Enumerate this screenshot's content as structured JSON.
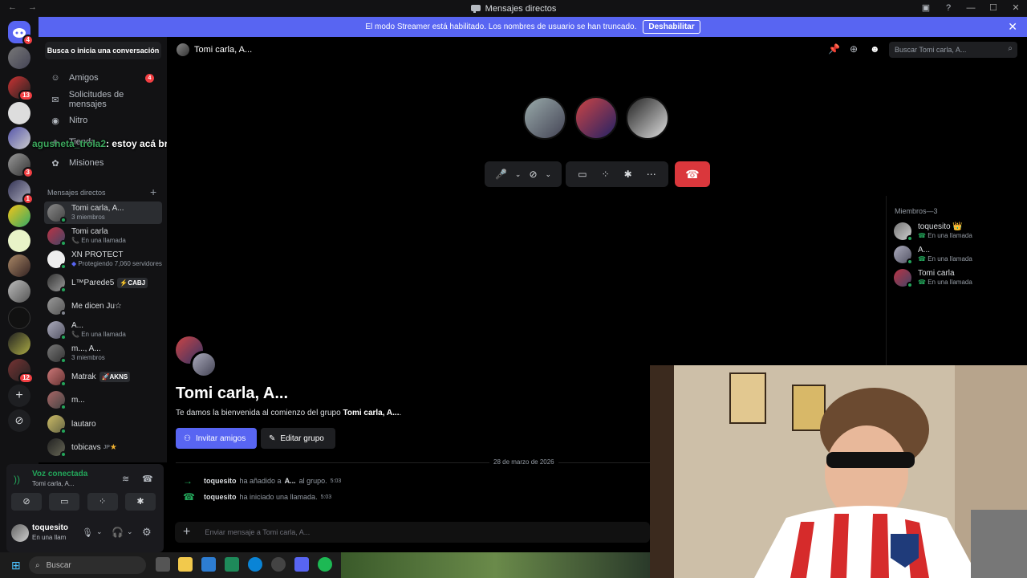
{
  "window": {
    "title": "Mensajes directos"
  },
  "banner": {
    "text": "El modo Streamer está habilitado. Los nombres de usuario se han truncado.",
    "button": "Deshabilitar"
  },
  "server_badges": [
    "4",
    "13",
    "3",
    "1",
    "12"
  ],
  "sidebar": {
    "search_placeholder": "Busca o inicia una conversación",
    "nav": [
      {
        "label": "Amigos",
        "badge": "4"
      },
      {
        "label": "Solicitudes de mensajes"
      },
      {
        "label": "Nitro"
      },
      {
        "label": "Tienda"
      },
      {
        "label": "Misiones"
      }
    ],
    "dm_header": "Mensajes directos",
    "dms": [
      {
        "name": "Tomi carla, A...",
        "sub": "3 miembros"
      },
      {
        "name": "Tomi carla",
        "sub": "En una llamada"
      },
      {
        "name": "XN PROTECT",
        "sub": "Protegiendo 7,060 servidores"
      },
      {
        "name": "L™Parede5",
        "tag": "CABJ"
      },
      {
        "name": "Me dicen Ju☆"
      },
      {
        "name": "A...",
        "sub": "En una llamada"
      },
      {
        "name": "m..., A...",
        "sub": "3 miembros"
      },
      {
        "name": "Matrak",
        "tag": "AKNS"
      },
      {
        "name": "m..."
      },
      {
        "name": "lautaro"
      },
      {
        "name": "tobicavs",
        "tag": "JP"
      }
    ]
  },
  "overlay_chat": {
    "user": "agusneta_trola2",
    "message": ": estoy acá bro"
  },
  "voice": {
    "status": "Voz conectada",
    "channel": "Tomi carla, A...",
    "user": "toquesito",
    "user_status": "En una llam"
  },
  "header": {
    "channel": "Tomi carla, A...",
    "search_placeholder": "Buscar Tomi carla, A..."
  },
  "members": {
    "title": "Miembros—3",
    "list": [
      {
        "name": "toquesito 👑",
        "status": "En una llamada"
      },
      {
        "name": "A...",
        "status": "En una llamada"
      },
      {
        "name": "Tomi carla",
        "status": "En una llamada"
      }
    ]
  },
  "welcome": {
    "title": "Tomi carla, A...",
    "sub_prefix": "Te damos la bienvenida al comienzo del grupo ",
    "sub_group": "Tomi carla, A...",
    "sub_suffix": ".",
    "invite": "Invitar amigos",
    "edit": "Editar grupo"
  },
  "date_divider": "28 de marzo de 2026",
  "system_messages": [
    {
      "user": "toquesito",
      "action": "ha añadido a",
      "target": "A...",
      "rest": "al grupo.",
      "time": "5:03"
    },
    {
      "user": "toquesito",
      "action": "ha iniciado una llamada.",
      "time": "5:03"
    }
  ],
  "input": {
    "placeholder": "Enviar mensaje a Tomi carla, A..."
  },
  "taskbar": {
    "search": "Buscar"
  },
  "colors": {
    "blurple": "#5865f2",
    "green": "#23a55a",
    "red": "#da373c"
  }
}
